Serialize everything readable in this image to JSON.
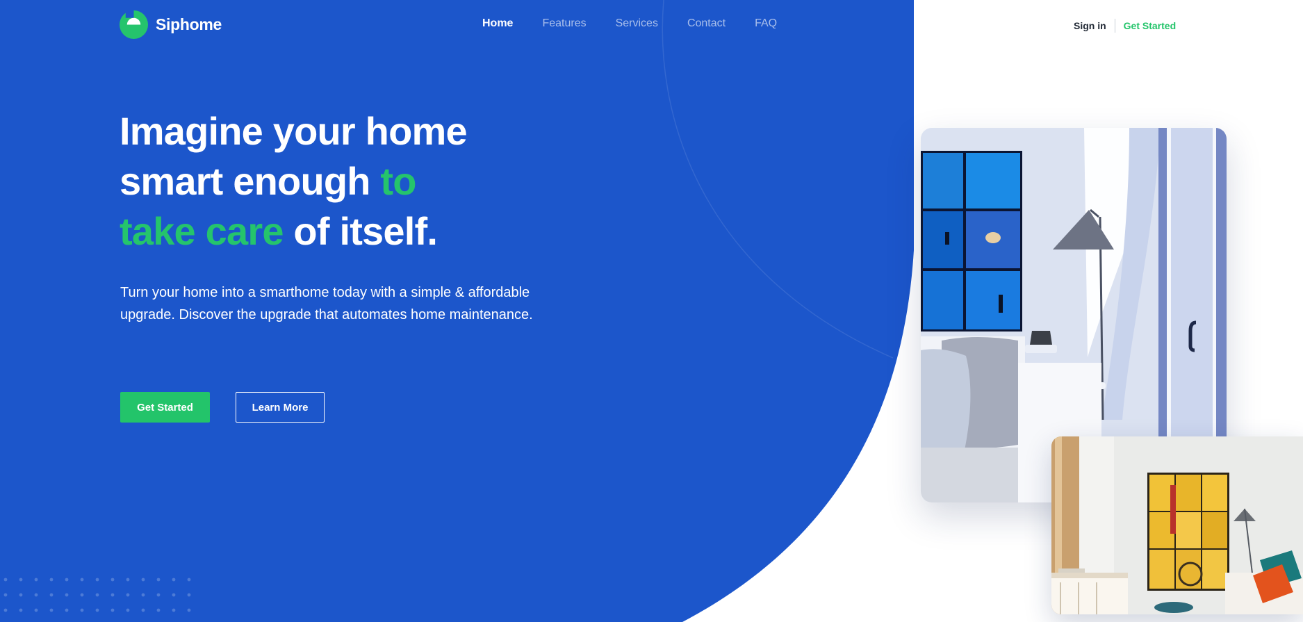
{
  "brand": {
    "name": "Siphome",
    "primary_color": "#1c56cb",
    "accent_color": "#23c46a"
  },
  "nav": {
    "items": [
      {
        "label": "Home",
        "active": true
      },
      {
        "label": "Features",
        "active": false
      },
      {
        "label": "Services",
        "active": false
      },
      {
        "label": "Contact",
        "active": false
      },
      {
        "label": "FAQ",
        "active": false
      }
    ]
  },
  "auth": {
    "signin_label": "Sign in",
    "cta_label": "Get Started"
  },
  "hero": {
    "headline": {
      "line1": "Imagine your home",
      "line2_plain": "smart enough ",
      "line2_highlight": "to",
      "line3_highlight": "take care",
      "line3_plain": " of itself."
    },
    "subtext": "Turn your home into a smarthome today with a simple & affordable upgrade. Discover the upgrade that automates home maintenance.",
    "primary_button": "Get Started",
    "secondary_button": "Learn More"
  },
  "images": {
    "main_photo": "living-room-blue-wall-art",
    "secondary_photo": "living-room-yellow-wall-art"
  }
}
